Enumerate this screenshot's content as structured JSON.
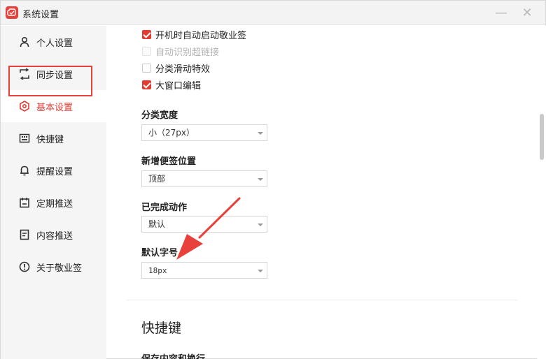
{
  "window": {
    "title": "系统设置",
    "minimize_glyph": "—",
    "close_glyph": "✕"
  },
  "sidebar": {
    "items": [
      {
        "label": "个人设置",
        "icon": "person-icon"
      },
      {
        "label": "同步设置",
        "icon": "sync-icon"
      },
      {
        "label": "基本设置",
        "icon": "hexagon-settings-icon",
        "active": true
      },
      {
        "label": "快捷键",
        "icon": "keyboard-icon"
      },
      {
        "label": "提醒设置",
        "icon": "bell-icon"
      },
      {
        "label": "定期推送",
        "icon": "calendar-icon"
      },
      {
        "label": "内容推送",
        "icon": "document-icon"
      },
      {
        "label": "关于敬业签",
        "icon": "info-icon"
      }
    ]
  },
  "main": {
    "checkboxes": [
      {
        "label": "开机时自动启动敬业签",
        "checked": true,
        "disabled": false
      },
      {
        "label": "自动识别超链接",
        "checked": false,
        "disabled": true
      },
      {
        "label": "分类滑动特效",
        "checked": false,
        "disabled": false
      },
      {
        "label": "大窗口编辑",
        "checked": true,
        "disabled": false
      }
    ],
    "category_width": {
      "label": "分类宽度",
      "value": "小（27px）"
    },
    "new_note_position": {
      "label": "新增便签位置",
      "value": "顶部"
    },
    "completed_action": {
      "label": "已完成动作",
      "value": "默认"
    },
    "default_font_size": {
      "label": "默认字号",
      "value": "18px"
    },
    "shortcut_section_title": "快捷键",
    "next_item_label": "保存内容和换行"
  },
  "colors": {
    "accent": "#e63b35",
    "annotation": "#e8403a"
  }
}
